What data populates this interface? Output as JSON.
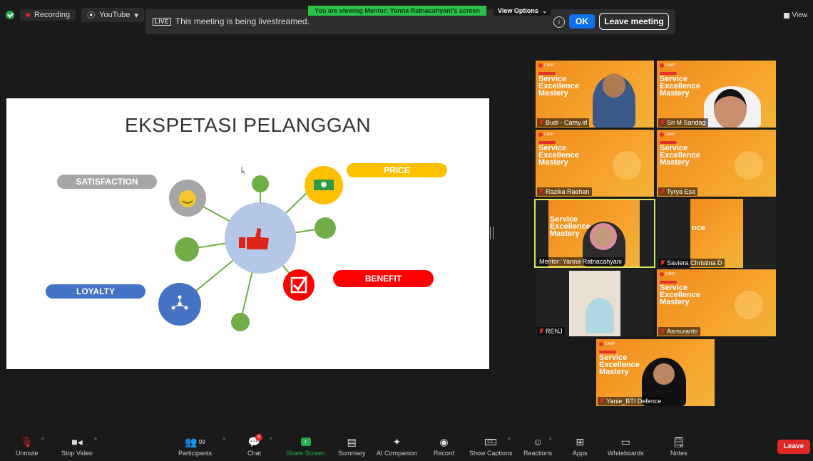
{
  "top": {
    "recording_label": "Recording",
    "youtube_label": "YouTube",
    "livestream_badge": "LIVE",
    "livestream_text": "This meeting is being livestreamed.",
    "viewing_banner": "You are viewing Mentor: Yanna Ratnacahyani's screen",
    "view_options": "View Options",
    "ok_label": "OK",
    "leave_meeting_label": "Leave meeting",
    "view_label": "View"
  },
  "slide": {
    "title": "EKSPETASI PELANGGAN",
    "labels": {
      "satisfaction": "SATISFACTION",
      "price": "PRICE",
      "benefit": "BENEFIT",
      "loyalty": "LOYALTY"
    },
    "colors": {
      "grey": "#a6a6a6",
      "yellow": "#ffc000",
      "red": "#ff0000",
      "blue": "#4472c4",
      "green": "#70ad47",
      "hub": "#b4c7e7"
    }
  },
  "promo": {
    "brand": "CAMY",
    "title_lines": [
      "Service",
      "Excellence",
      "Mastery"
    ]
  },
  "participants": [
    {
      "name": "Budi - Camy.id"
    },
    {
      "name": "Sri M Sandag"
    },
    {
      "name": "Razika Raehan"
    },
    {
      "name": "Tyrya Esa"
    },
    {
      "name": "Mentor: Yanna Ratnacahyani"
    },
    {
      "name": "Saviera Christina D"
    },
    {
      "name": "RENJ"
    },
    {
      "name": "Asmuranto"
    },
    {
      "name": "Yanie_BTI Defence"
    }
  ],
  "toolbar": {
    "unmute": "Unmute",
    "stop_video": "Stop Video",
    "participants": "Participants",
    "participants_count": "99",
    "chat": "Chat",
    "chat_badge": "3",
    "share_screen": "Share Screen",
    "summary": "Summary",
    "ai_companion": "AI Companion",
    "record": "Record",
    "show_captions": "Show Captions",
    "reactions": "Reactions",
    "apps": "Apps",
    "whiteboards": "Whiteboards",
    "notes": "Notes",
    "leave": "Leave"
  }
}
